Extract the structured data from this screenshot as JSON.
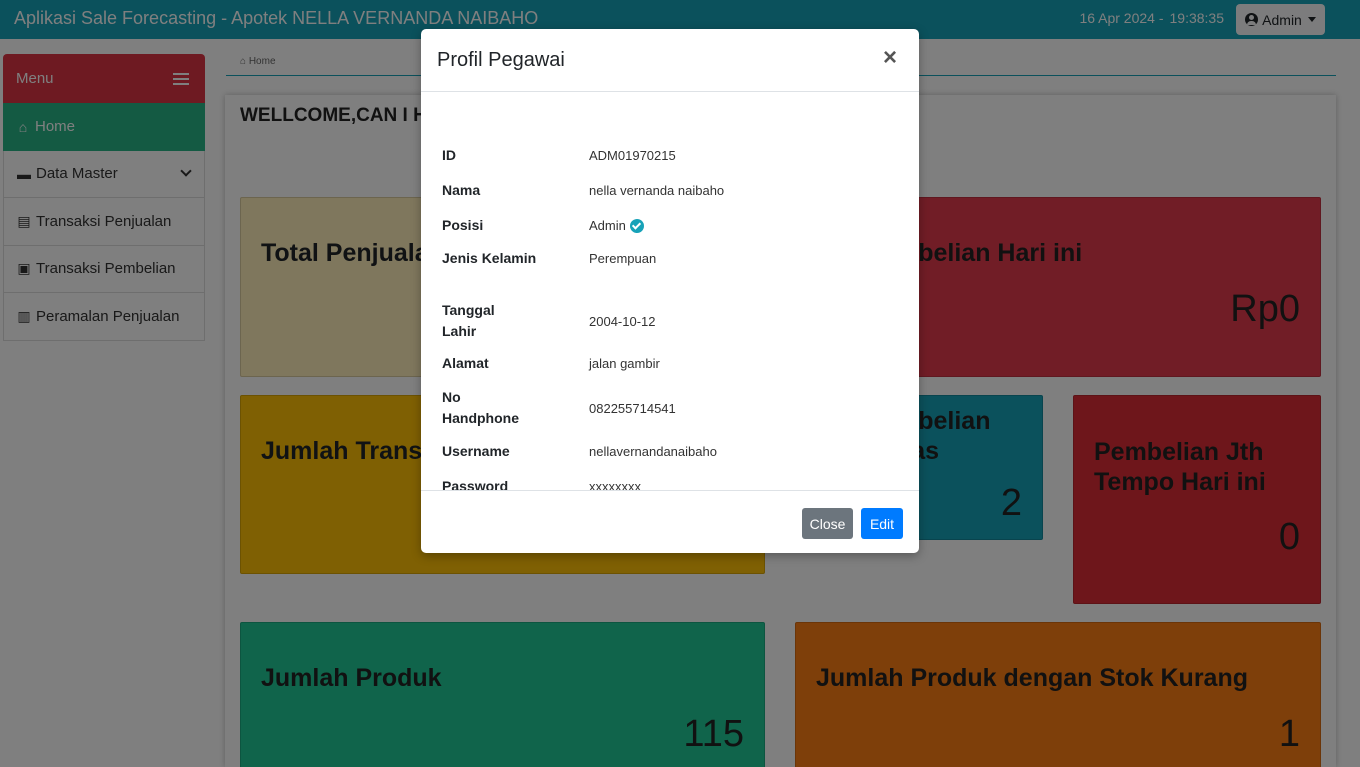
{
  "navbar": {
    "title": "Aplikasi Sale Forecasting - Apotek NELLA VERNANDA NAIBAHO",
    "date": "16 Apr 2024 -",
    "time": "19:38:35",
    "user_label": "Admin"
  },
  "sidebar": {
    "menu_label": "Menu",
    "items": [
      {
        "label": "Home",
        "icon": "home-icon"
      },
      {
        "label": "Data Master",
        "icon": "folder-icon"
      },
      {
        "label": "Transaksi Penjualan",
        "icon": "invoice-icon"
      },
      {
        "label": "Transaksi Pembelian",
        "icon": "bag-icon"
      },
      {
        "label": "Peramalan Penjualan",
        "icon": "chart-icon"
      }
    ]
  },
  "breadcrumb": {
    "label": "Home"
  },
  "main": {
    "welcome": "WELLCOME,CAN I H",
    "cards": {
      "total_penjualan": {
        "title": "Total Penjualan"
      },
      "pembelian_hari_ini": {
        "title": "mbelian Hari ini",
        "value": "Rp0"
      },
      "jumlah_transaksi": {
        "title": "Jumlah Transa"
      },
      "pembelian_lunas": {
        "title": "mbelian\nnas",
        "value": "2"
      },
      "pembelian_jatuh_tempo": {
        "title": "Pembelian Jth Tempo Hari ini",
        "value": "0"
      },
      "jumlah_produk": {
        "title": "Jumlah Produk",
        "value": "115"
      },
      "produk_stok_kurang": {
        "title": "Jumlah Produk dengan Stok Kurang",
        "value": "1"
      }
    }
  },
  "modal": {
    "title": "Profil Pegawai",
    "close_symbol": "×",
    "fields": [
      {
        "label": "ID",
        "value": "ADM01970215"
      },
      {
        "label": "Nama",
        "value": "nella vernanda naibaho"
      },
      {
        "label": "Posisi",
        "value": "Admin"
      },
      {
        "label": "Jenis Kelamin",
        "value": "Perempuan"
      },
      {
        "label": "Tanggal Lahir",
        "value": "2004-10-12"
      },
      {
        "label": "Alamat",
        "value": "jalan gambir"
      },
      {
        "label": "No Handphone",
        "value": "082255714541"
      },
      {
        "label": "Username",
        "value": "nellavernandanaibaho"
      },
      {
        "label": "Password",
        "value": "xxxxxxxx"
      }
    ],
    "buttons": {
      "close": "Close",
      "edit": "Edit"
    }
  },
  "colors": {
    "navbar": "#17a2b8",
    "menu_header": "#dc3545",
    "home_active": "#28b487",
    "btn_secondary": "#6c757d",
    "btn_primary": "#007bff"
  }
}
